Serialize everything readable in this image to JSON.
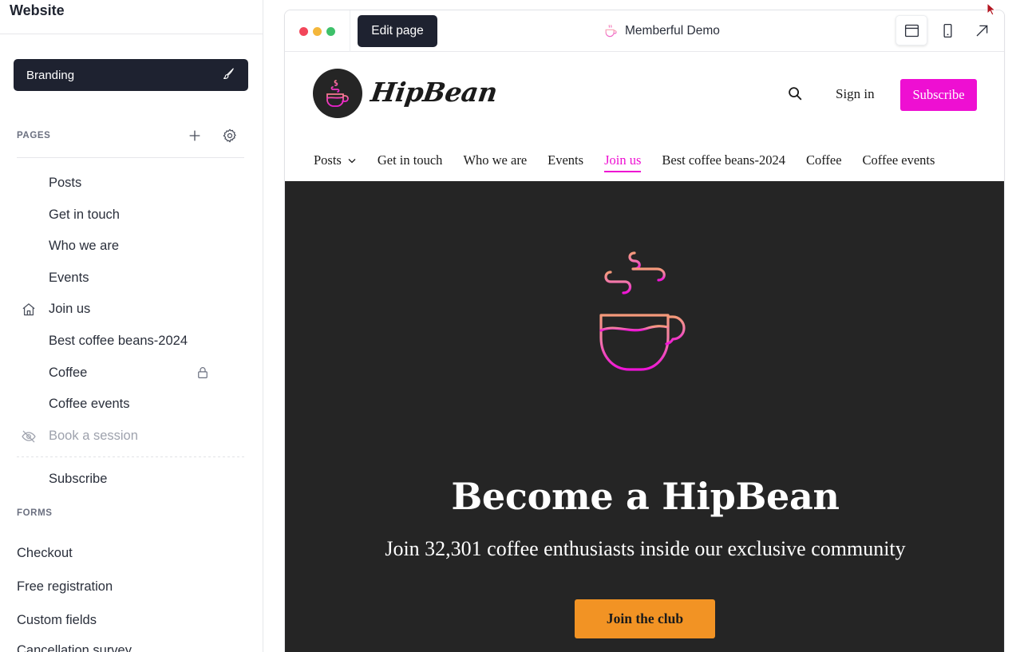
{
  "sidebar": {
    "title": "Website",
    "branding_label": "Branding",
    "pages_label": "PAGES",
    "pages": [
      {
        "label": "Posts",
        "icon": ""
      },
      {
        "label": "Get in touch",
        "icon": ""
      },
      {
        "label": "Who we are",
        "icon": ""
      },
      {
        "label": "Events",
        "icon": ""
      },
      {
        "label": "Join us",
        "icon": "home-icon"
      },
      {
        "label": "Best coffee beans-2024",
        "icon": ""
      },
      {
        "label": "Coffee",
        "icon": "",
        "locked": true
      },
      {
        "label": "Coffee events",
        "icon": ""
      },
      {
        "label": "Book a session",
        "icon": "eye-off-icon",
        "hidden": true
      }
    ],
    "extra_pages": [
      {
        "label": "Subscribe"
      }
    ],
    "forms_label": "FORMS",
    "forms": [
      {
        "label": "Checkout"
      },
      {
        "label": "Free registration"
      },
      {
        "label": "Custom fields"
      },
      {
        "label": "Cancellation survey"
      }
    ]
  },
  "preview": {
    "edit_button": "Edit page",
    "site_title": "Memberful Demo",
    "view_modes": [
      "desktop-icon",
      "mobile-icon",
      "open-external-icon"
    ]
  },
  "site": {
    "brand": "HipBean",
    "sign_in": "Sign in",
    "subscribe": "Subscribe",
    "nav": [
      {
        "label": "Posts",
        "dropdown": true
      },
      {
        "label": "Get in touch"
      },
      {
        "label": "Who we are"
      },
      {
        "label": "Events"
      },
      {
        "label": "Join us",
        "active": true
      },
      {
        "label": "Best coffee beans-2024"
      },
      {
        "label": "Coffee"
      },
      {
        "label": "Coffee events"
      }
    ],
    "hero": {
      "title": "Become a HipBean",
      "subtitle": "Join 32,301 coffee enthusiasts inside our exclusive community",
      "cta": "Join the club"
    }
  },
  "colors": {
    "sidebar_dark": "#1e2230",
    "brand_pink": "#ee0fd2",
    "cta_orange": "#f29324",
    "hero_bg": "#252525"
  }
}
